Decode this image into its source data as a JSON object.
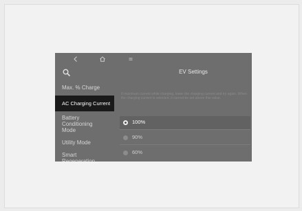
{
  "topbar": {
    "back_icon": "back-arrow-icon",
    "home_icon": "home-icon",
    "menu_icon": "menu-icon"
  },
  "main": {
    "title": "EV Settings",
    "description": "If maximum current while charging, lower the charging current and try again. When the charging current is selected, it cannot be set above this value."
  },
  "sidebar": {
    "search_icon": "search-icon",
    "items": [
      {
        "label": "Max. % Charge"
      },
      {
        "label": "AC Charging Current"
      },
      {
        "label": "Battery Conditioning Mode"
      },
      {
        "label": "Utility Mode"
      },
      {
        "label": "Smart Regeneration"
      }
    ],
    "active_index": 1
  },
  "options": [
    {
      "label": "100%",
      "selected": true
    },
    {
      "label": "90%",
      "selected": false
    },
    {
      "label": "60%",
      "selected": false
    }
  ],
  "colors": {
    "screen_bg": "#6e6e6e",
    "active_item_bg": "#1a1a1a",
    "text_light": "#e8e8e8",
    "text_muted": "#8a8a8a"
  }
}
